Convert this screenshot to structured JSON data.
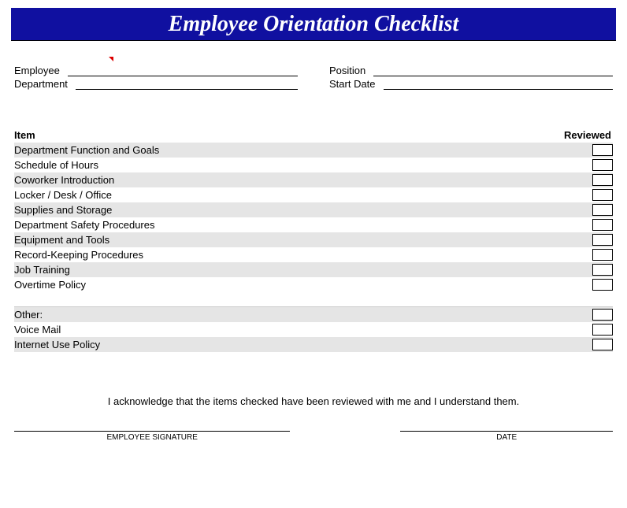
{
  "title": "Employee Orientation Checklist",
  "fields": {
    "employee_label": "Employee",
    "department_label": "Department",
    "position_label": "Position",
    "start_date_label": "Start Date"
  },
  "headers": {
    "item": "Item",
    "reviewed": "Reviewed"
  },
  "items": [
    "Department Function and Goals",
    "Schedule of Hours",
    "Coworker Introduction",
    "Locker / Desk / Office",
    "Supplies and Storage",
    "Department Safety Procedures",
    "Equipment and Tools",
    "Record-Keeping Procedures",
    "Job Training",
    "Overtime Policy"
  ],
  "other_label": "Other:",
  "other_items": [
    "Voice Mail",
    "Internet Use Policy"
  ],
  "acknowledgment": "I acknowledge that the items checked have been reviewed with me and I understand them.",
  "signature": {
    "employee": "EMPLOYEE SIGNATURE",
    "date": "DATE"
  }
}
